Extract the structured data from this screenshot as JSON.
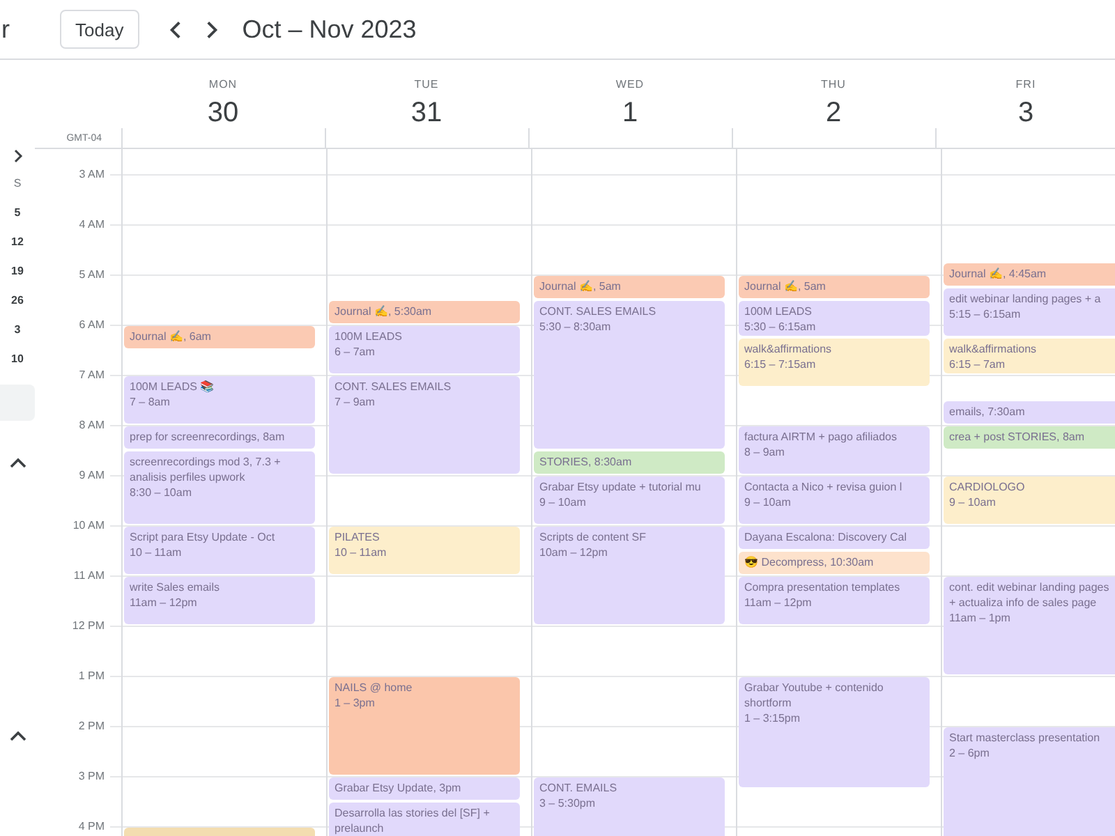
{
  "app_title_fragment": "r",
  "toolbar": {
    "today_button": "Today",
    "range_title": "Oct – Nov 2023"
  },
  "sidebar": {
    "mini_calendar_dates": [
      "S",
      "5",
      "12",
      "19",
      "26",
      "3",
      "10"
    ]
  },
  "timezone": "GMT-04",
  "hours": [
    "3 AM",
    "4 AM",
    "5 AM",
    "6 AM",
    "7 AM",
    "8 AM",
    "9 AM",
    "10 AM",
    "11 AM",
    "12 PM",
    "1 PM",
    "2 PM",
    "3 PM",
    "4 PM"
  ],
  "days": [
    {
      "name": "MON",
      "date": "30",
      "events": [
        {
          "title": "Journal ✍, 6am",
          "color": "#fbcab3"
        },
        {
          "title": "100M LEADS 📚",
          "time": "7 – 8am",
          "color": "#e1d9fb"
        },
        {
          "title": "prep for screenrecordings, 8am",
          "color": "#e1d9fb"
        },
        {
          "title": "screenrecordings mod 3, 7.3 + analisis perfiles upwork",
          "time": "8:30 – 10am",
          "color": "#e1d9fb"
        },
        {
          "title": "Script para Etsy Update - Oct",
          "time": "10 – 11am",
          "color": "#e1d9fb"
        },
        {
          "title": "write Sales emails",
          "time": "11am – 12pm",
          "color": "#e1d9fb"
        },
        {
          "color": "#f3ddb0"
        }
      ]
    },
    {
      "name": "TUE",
      "date": "31",
      "events": [
        {
          "title": "Journal ✍, 5:30am",
          "color": "#fbcab3"
        },
        {
          "title": "100M LEADS",
          "time": "6 – 7am",
          "color": "#e1d9fb"
        },
        {
          "title": "CONT. SALES EMAILS",
          "time": "7 – 9am",
          "color": "#e1d9fb"
        },
        {
          "title": "PILATES",
          "time": "10 – 11am",
          "color": "#fdeecb"
        },
        {
          "title": "NAILS @ home",
          "time": "1 – 3pm",
          "color": "#fbc6ab"
        },
        {
          "title": "Grabar Etsy Update, 3pm",
          "color": "#e1d9fb"
        },
        {
          "title": "Desarrolla las stories del [SF] + prelaunch",
          "color": "#e1d9fb"
        }
      ]
    },
    {
      "name": "WED",
      "date": "1",
      "events": [
        {
          "title": "Journal ✍, 5am",
          "color": "#fbcab3"
        },
        {
          "title": "CONT. SALES EMAILS",
          "time": "5:30 – 8:30am",
          "color": "#e1d9fb"
        },
        {
          "title": "STORIES, 8:30am",
          "color": "#cfeac5"
        },
        {
          "title": "Grabar Etsy update + tutorial mu",
          "time": "9 – 10am",
          "color": "#e1d9fb"
        },
        {
          "title": "Scripts de content SF",
          "time": "10am – 12pm",
          "color": "#e1d9fb"
        },
        {
          "title": "CONT. EMAILS",
          "time": "3 – 5:30pm",
          "color": "#e1d9fb"
        }
      ]
    },
    {
      "name": "THU",
      "date": "2",
      "events": [
        {
          "title": "Journal ✍, 5am",
          "color": "#fbcab3"
        },
        {
          "title": "100M LEADS",
          "time": "5:30 – 6:15am",
          "color": "#e1d9fb"
        },
        {
          "title": "walk&affirmations",
          "time": "6:15 – 7:15am",
          "color": "#fdeecb"
        },
        {
          "title": "factura AIRTM + pago afiliados",
          "time": "8 – 9am",
          "color": "#e1d9fb"
        },
        {
          "title": "Contacta a Nico + revisa guion l",
          "time": "9 – 10am",
          "color": "#e1d9fb"
        },
        {
          "title": "Dayana Escalona: Discovery Cal",
          "color": "#e1d9fb"
        },
        {
          "title": "😎 Decompress, 10:30am",
          "color": "#fde2cc"
        },
        {
          "title": "Compra presentation templates",
          "time": "11am – 12pm",
          "color": "#e1d9fb"
        },
        {
          "title": "Grabar Youtube + contenido shortform",
          "time": "1 – 3:15pm",
          "color": "#e1d9fb"
        }
      ]
    },
    {
      "name": "FRI",
      "date": "3",
      "events": [
        {
          "title": "Journal ✍, 4:45am",
          "color": "#fbcab3"
        },
        {
          "title": "edit webinar landing pages + a",
          "time": "5:15 – 6:15am",
          "color": "#e1d9fb"
        },
        {
          "title": "walk&affirmations",
          "time": "6:15 – 7am",
          "color": "#fdeecb"
        },
        {
          "title": "emails, 7:30am",
          "color": "#e1d9fb"
        },
        {
          "title": "crea + post STORIES, 8am",
          "color": "#cfeac5"
        },
        {
          "title": "CARDIOLOGO",
          "time": "9 – 10am",
          "color": "#fdeecb"
        },
        {
          "title": "cont. edit webinar landing pages + actualiza info de sales page",
          "time": "11am – 1pm",
          "color": "#e1d9fb"
        },
        {
          "title": "Start masterclass presentation",
          "time": "2 – 6pm",
          "color": "#e1d9fb"
        }
      ]
    }
  ]
}
